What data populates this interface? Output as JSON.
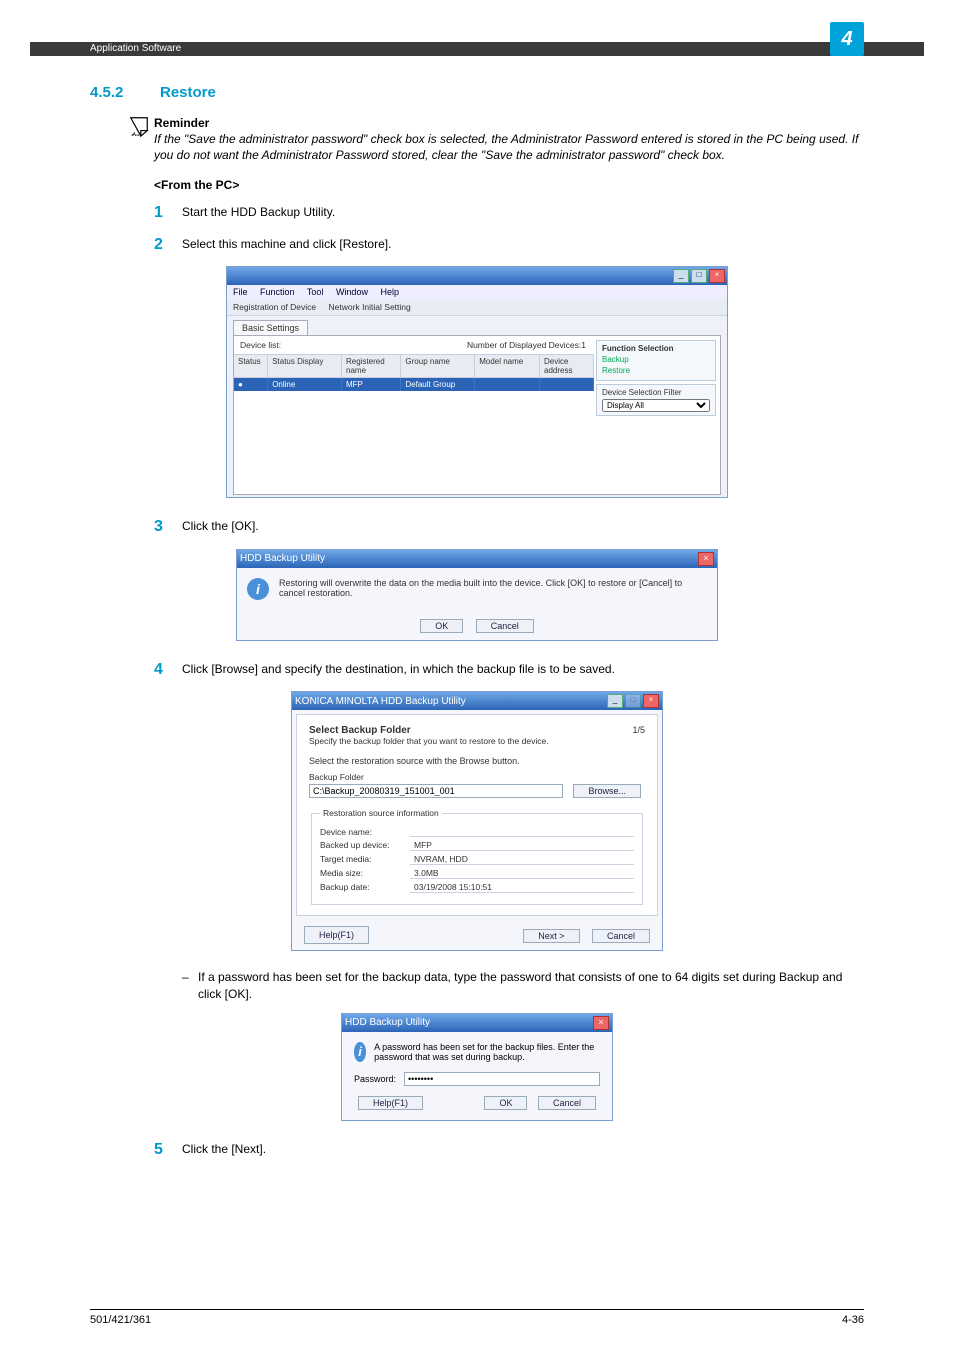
{
  "header": {
    "section": "Application Software",
    "chapter_num": "4"
  },
  "section": {
    "number": "4.5.2",
    "title": "Restore"
  },
  "reminder": {
    "label": "Reminder",
    "text": "If the \"Save the administrator password\" check box is selected, the Administrator Password entered is stored in the PC being used. If you do not want the Administrator Password stored, clear the \"Save the administrator password\" check box."
  },
  "from_pc": "<From the PC>",
  "steps": {
    "s1": "Start the HDD Backup Utility.",
    "s2": "Select this machine and click [Restore].",
    "s3": "Click the [OK].",
    "s4": "Click [Browse] and specify the destination, in which the backup file is to be saved.",
    "s4_sub": "If a password has been set for the backup data, type the password that consists of one to 64 digits set during Backup and click [OK].",
    "s5": "Click the [Next]."
  },
  "shot1": {
    "menus": {
      "file": "File",
      "func": "Function",
      "tool": "Tool",
      "win": "Window",
      "help": "Help"
    },
    "toolbar": {
      "reg": "Registration of Device",
      "net": "Network Initial Setting"
    },
    "tab": "Basic Settings",
    "devlist": "Device list:",
    "count_label": "Number of Displayed Devices:1",
    "cols": {
      "status": "Status",
      "sd": "Status Display",
      "rn": "Registered name",
      "gn": "Group name",
      "mn": "Model name",
      "da": "Device address"
    },
    "row": {
      "icon": "●",
      "sd": "Online",
      "rn": "MFP",
      "gn": "Default Group",
      "mn": "",
      "da": ""
    },
    "side": {
      "fs": "Function Selection",
      "backup": "Backup",
      "restore": "Restore",
      "dsf": "Device Selection Filter",
      "all": "Display All"
    }
  },
  "shot2": {
    "title": "HDD Backup Utility",
    "msg": "Restoring will overwrite the data on the media built into the device. Click [OK] to restore or [Cancel] to cancel restoration.",
    "ok": "OK",
    "cancel": "Cancel"
  },
  "shot3": {
    "title": "KONICA MINOLTA HDD Backup Utility",
    "heading": "Select Backup Folder",
    "sub": "Specify the backup folder that you want to restore to the device.",
    "page": "1/5",
    "hint": "Select the restoration source with the Browse button.",
    "bf_label": "Backup Folder",
    "bf_value": "C:\\Backup_20080319_151001_001",
    "browse": "Browse...",
    "grp": "Restoration source information",
    "dn": {
      "k": "Device name:",
      "v": ""
    },
    "bd": {
      "k": "Backed up device:",
      "v": "MFP"
    },
    "tm": {
      "k": "Target media:",
      "v": "NVRAM, HDD"
    },
    "ms": {
      "k": "Media size:",
      "v": "3.0MB"
    },
    "bdate": {
      "k": "Backup date:",
      "v": "03/19/2008 15:10:51"
    },
    "help": "Help(F1)",
    "next": "Next >",
    "cancel": "Cancel"
  },
  "shot4": {
    "title": "HDD Backup Utility",
    "msg": "A password has been set for the backup files. Enter the password that was set during backup.",
    "pwd_label": "Password:",
    "pwd_value": "********",
    "help": "Help(F1)",
    "ok": "OK",
    "cancel": "Cancel"
  },
  "footer": {
    "left": "501/421/361",
    "right": "4-36"
  }
}
